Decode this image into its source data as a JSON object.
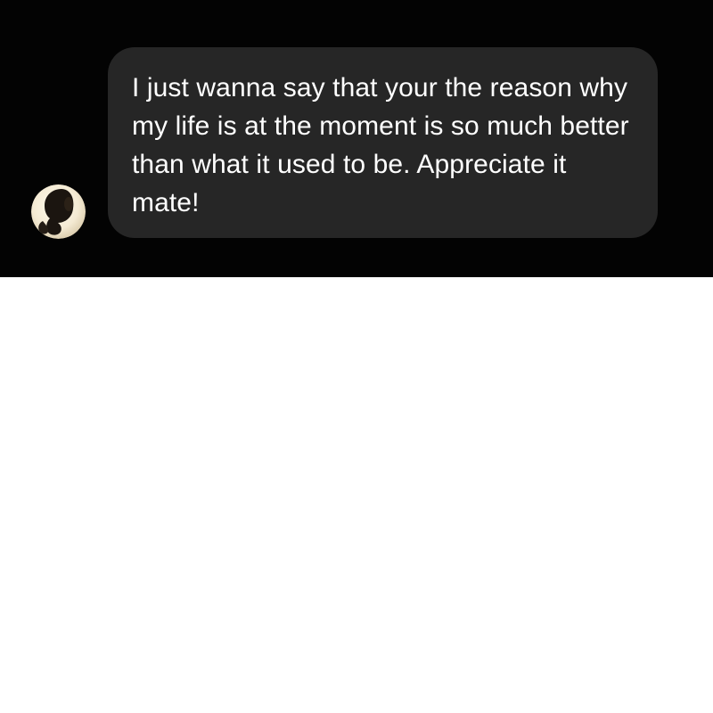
{
  "conversation": {
    "message": {
      "text": "I just wanna say that your the reason why my life is at the moment is so much better than what it used to be. Appreciate it mate!"
    },
    "avatar": {
      "icon": "profile-photo"
    }
  },
  "colors": {
    "panel_background": "#030303",
    "bubble_background": "#262626",
    "message_text": "#ffffff",
    "page_background": "#ffffff"
  }
}
